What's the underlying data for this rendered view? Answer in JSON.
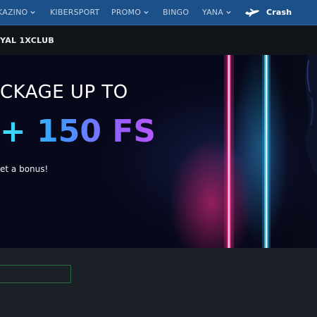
{
  "nav": {
    "items": [
      {
        "label": "KAZINO",
        "dropdown": true
      },
      {
        "label": "KIBERSPORT",
        "dropdown": false
      },
      {
        "label": "PROMO",
        "dropdown": true
      },
      {
        "label": "BINGO",
        "dropdown": false
      },
      {
        "label": "YANA",
        "dropdown": true
      },
      {
        "label": "Crash",
        "dropdown": false,
        "icon": "airplane-icon"
      }
    ]
  },
  "subbar": {
    "title": "YAL 1XCLUB"
  },
  "banner": {
    "line1": "CKAGE UP TO",
    "line2": "+ 150 FS",
    "line3": "et a bonus!"
  },
  "lower": {
    "input_value": ""
  },
  "colors": {
    "nav_bg": "#1c5089",
    "subbar_bg": "#111418",
    "page_bg": "#1b2026",
    "neon_pink": "#ff2a86",
    "neon_cyan": "#28c8ff",
    "input_border": "#2f6b45"
  }
}
